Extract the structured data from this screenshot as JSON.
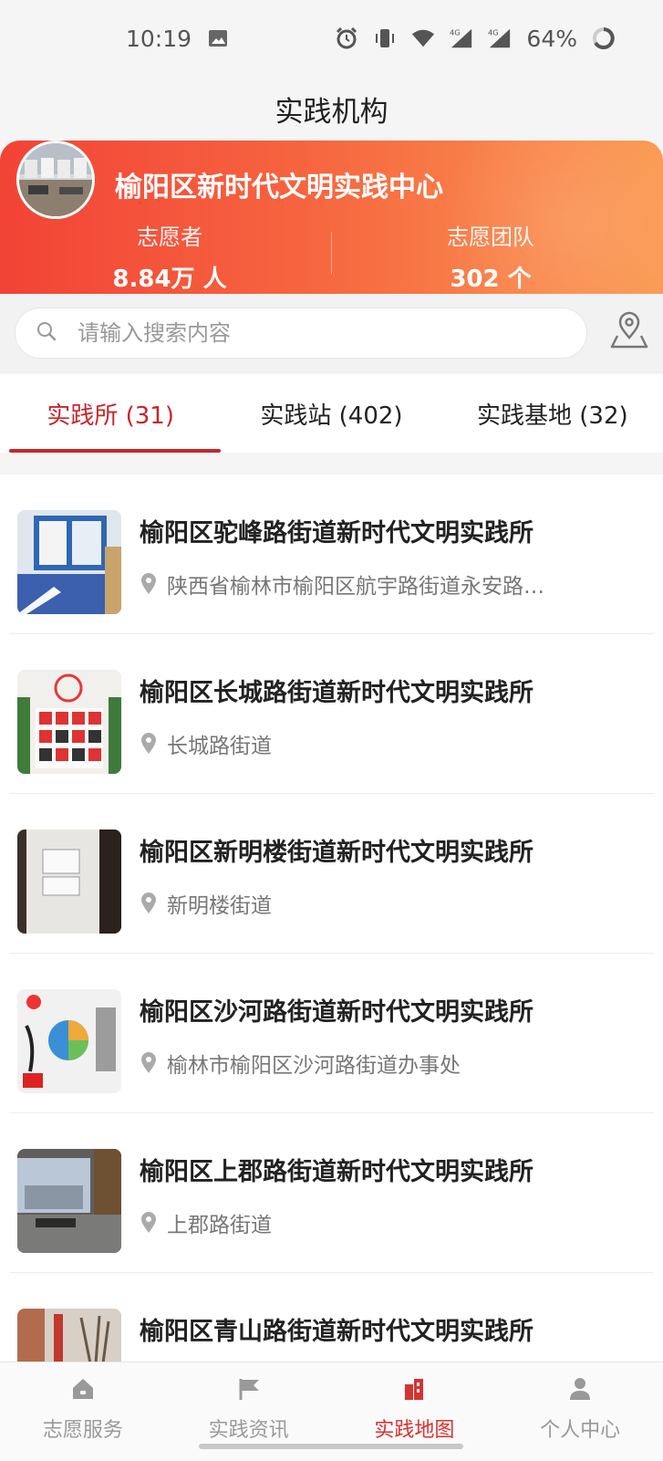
{
  "status_bar": {
    "time": "10:19",
    "battery": "64%",
    "icons": [
      "image-icon",
      "alarm-icon",
      "vibrate-icon",
      "wifi-icon",
      "signal-4g-icon",
      "signal-4g-icon",
      "battery-ring-icon"
    ]
  },
  "header": {
    "title": "实践机构"
  },
  "banner": {
    "center_name": "榆阳区新时代文明实践中心",
    "volunteers_label": "志愿者",
    "volunteers_value": "8.84万 人",
    "teams_label": "志愿团队",
    "teams_value": "302 个"
  },
  "search": {
    "placeholder": "请输入搜索内容",
    "value": ""
  },
  "tabs": [
    {
      "label": "实践所 (31)",
      "active": true
    },
    {
      "label": "实践站 (402)",
      "active": false
    },
    {
      "label": "实践基地 (32)",
      "active": false
    }
  ],
  "items": [
    {
      "title": "榆阳区驼峰路街道新时代文明实践所",
      "address": "陕西省榆林市榆阳区航宇路街道永安路…"
    },
    {
      "title": "榆阳区长城路街道新时代文明实践所",
      "address": "长城路街道"
    },
    {
      "title": "榆阳区新明楼街道新时代文明实践所",
      "address": "新明楼街道"
    },
    {
      "title": "榆阳区沙河路街道新时代文明实践所",
      "address": "榆林市榆阳区沙河路街道办事处"
    },
    {
      "title": "榆阳区上郡路街道新时代文明实践所",
      "address": "上郡路街道"
    },
    {
      "title": "榆阳区青山路街道新时代文明实践所",
      "address": ""
    }
  ],
  "bottom_nav": [
    {
      "label": "志愿服务",
      "icon": "home-icon",
      "active": false
    },
    {
      "label": "实践资讯",
      "icon": "flag-icon",
      "active": false
    },
    {
      "label": "实践地图",
      "icon": "map-building-icon",
      "active": true
    },
    {
      "label": "个人中心",
      "icon": "user-icon",
      "active": false
    }
  ],
  "colors": {
    "accent": "#c8262b",
    "banner_start": "#f24336",
    "banner_end": "#fb9a52",
    "nav_active": "#d8322f"
  }
}
